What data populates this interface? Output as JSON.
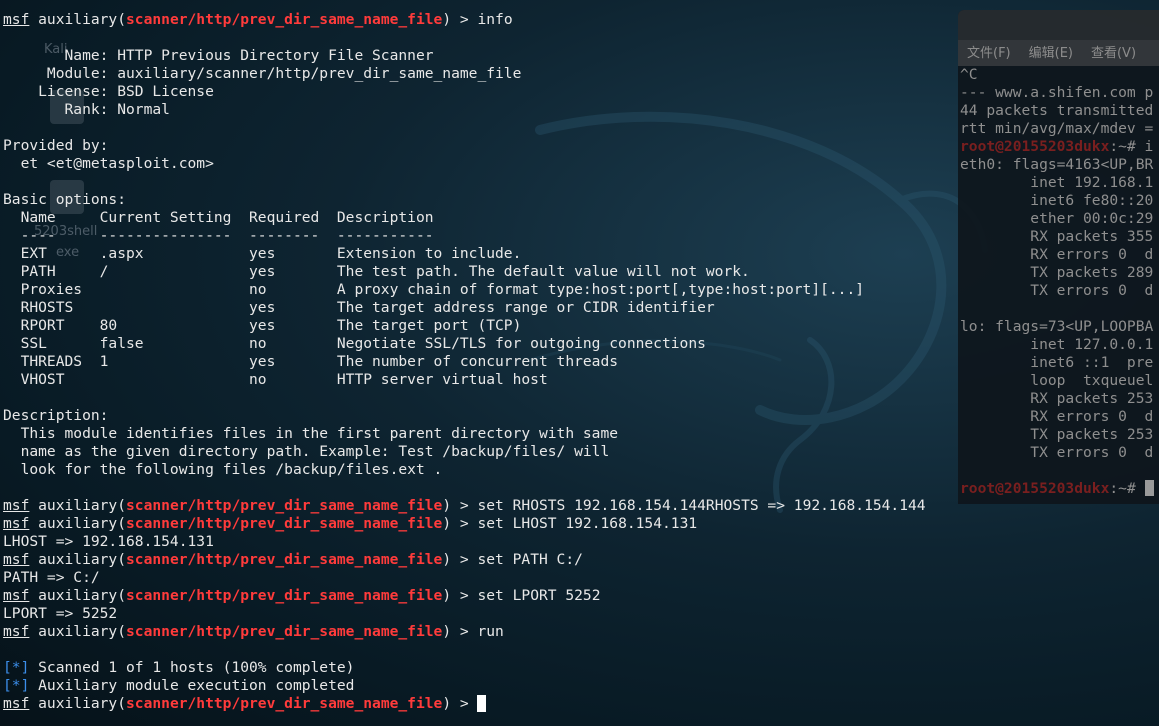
{
  "desktop_icons": [
    {
      "label": "Kali"
    },
    {
      "label": ""
    },
    {
      "label": "5203shell"
    },
    {
      "label": "exe"
    }
  ],
  "bg_terminal": {
    "menu": [
      "文件(F)",
      "编辑(E)",
      "查看(V)"
    ],
    "lines": [
      {
        "text": "^C"
      },
      {
        "text": "--- www.a.shifen.com p"
      },
      {
        "text": "44 packets transmitted"
      },
      {
        "text": "rtt min/avg/max/mdev ="
      },
      {
        "prompt": "root@20155203dukx",
        "rest": ":~# i"
      },
      {
        "text": "eth0: flags=4163<UP,BR"
      },
      {
        "text": "        inet 192.168.1"
      },
      {
        "text": "        inet6 fe80::20"
      },
      {
        "text": "        ether 00:0c:29"
      },
      {
        "text": "        RX packets 355"
      },
      {
        "text": "        RX errors 0  d"
      },
      {
        "text": "        TX packets 289"
      },
      {
        "text": "        TX errors 0  d"
      },
      {
        "text": ""
      },
      {
        "text": "lo: flags=73<UP,LOOPBA"
      },
      {
        "text": "        inet 127.0.0.1"
      },
      {
        "text": "        inet6 ::1  pre"
      },
      {
        "text": "        loop  txqueuel"
      },
      {
        "text": "        RX packets 253"
      },
      {
        "text": "        RX errors 0  d"
      },
      {
        "text": "        TX packets 253"
      },
      {
        "text": "        TX errors 0  d"
      },
      {
        "text": ""
      },
      {
        "prompt": "root@20155203dukx",
        "rest": ":~# "
      }
    ]
  },
  "terminal": {
    "prompt": {
      "msf": "msf",
      "pre": " auxiliary(",
      "module": "scanner/http/prev_dir_same_name_file",
      "post": ") > "
    },
    "lines": [
      {
        "type": "prompt",
        "cmd": "info"
      },
      {
        "type": "text",
        "text": ""
      },
      {
        "type": "text",
        "text": "       Name: HTTP Previous Directory File Scanner"
      },
      {
        "type": "text",
        "text": "     Module: auxiliary/scanner/http/prev_dir_same_name_file"
      },
      {
        "type": "text",
        "text": "    License: BSD License"
      },
      {
        "type": "text",
        "text": "       Rank: Normal"
      },
      {
        "type": "text",
        "text": ""
      },
      {
        "type": "text",
        "text": "Provided by:"
      },
      {
        "type": "text",
        "text": "  et <et@metasploit.com>"
      },
      {
        "type": "text",
        "text": ""
      },
      {
        "type": "text",
        "text": "Basic options:"
      },
      {
        "type": "text",
        "text": "  Name     Current Setting  Required  Description"
      },
      {
        "type": "text",
        "text": "  ----     ---------------  --------  -----------"
      },
      {
        "type": "text",
        "text": "  EXT      .aspx            yes       Extension to include."
      },
      {
        "type": "text",
        "text": "  PATH     /                yes       The test path. The default value will not work."
      },
      {
        "type": "text",
        "text": "  Proxies                   no        A proxy chain of format type:host:port[,type:host:port][...]"
      },
      {
        "type": "text",
        "text": "  RHOSTS                    yes       The target address range or CIDR identifier"
      },
      {
        "type": "text",
        "text": "  RPORT    80               yes       The target port (TCP)"
      },
      {
        "type": "text",
        "text": "  SSL      false            no        Negotiate SSL/TLS for outgoing connections"
      },
      {
        "type": "text",
        "text": "  THREADS  1                yes       The number of concurrent threads"
      },
      {
        "type": "text",
        "text": "  VHOST                     no        HTTP server virtual host"
      },
      {
        "type": "text",
        "text": ""
      },
      {
        "type": "text",
        "text": "Description:"
      },
      {
        "type": "text",
        "text": "  This module identifies files in the first parent directory with same"
      },
      {
        "type": "text",
        "text": "  name as the given directory path. Example: Test /backup/files/ will"
      },
      {
        "type": "text",
        "text": "  look for the following files /backup/files.ext ."
      },
      {
        "type": "text",
        "text": ""
      },
      {
        "type": "prompt",
        "cmd": "set RHOSTS 192.168.154.144RHOSTS => 192.168.154.144"
      },
      {
        "type": "prompt",
        "cmd": "set LHOST 192.168.154.131"
      },
      {
        "type": "text",
        "text": "LHOST => 192.168.154.131"
      },
      {
        "type": "prompt",
        "cmd": "set PATH C:/"
      },
      {
        "type": "text",
        "text": "PATH => C:/"
      },
      {
        "type": "prompt",
        "cmd": "set LPORT 5252"
      },
      {
        "type": "text",
        "text": "LPORT => 5252"
      },
      {
        "type": "prompt",
        "cmd": "run"
      },
      {
        "type": "text",
        "text": ""
      },
      {
        "type": "status",
        "mark": "[*]",
        "text": " Scanned 1 of 1 hosts (100% complete)"
      },
      {
        "type": "status",
        "mark": "[*]",
        "text": " Auxiliary module execution completed"
      },
      {
        "type": "prompt",
        "cmd": "",
        "cursor": true
      }
    ]
  }
}
